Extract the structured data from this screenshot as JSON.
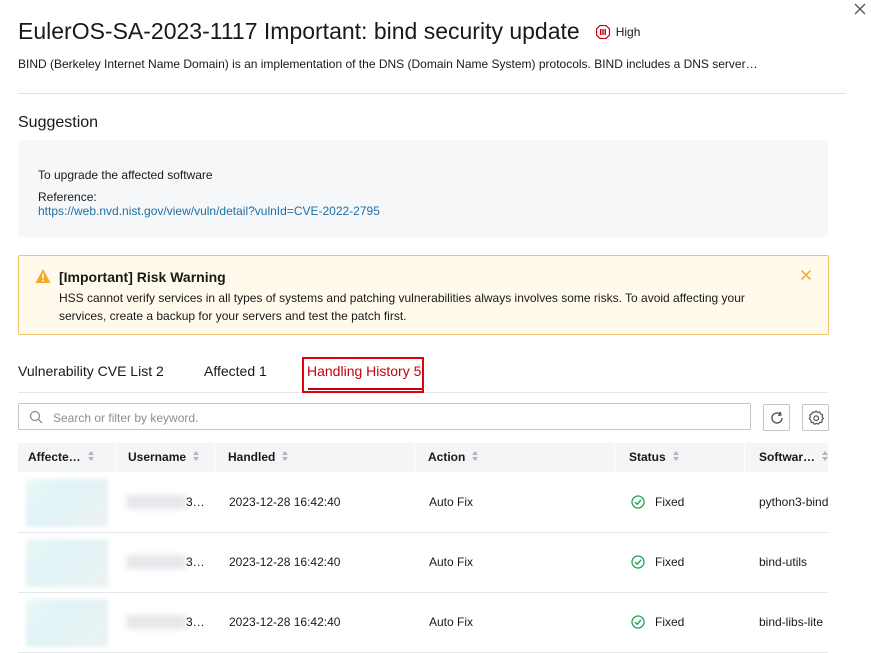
{
  "header": {
    "title": "EulerOS-SA-2023-1117 Important: bind security update",
    "severity": "High",
    "description": "BIND (Berkeley Internet Name Domain) is an implementation of the DNS (Domain Name System) protocols. BIND includes a DNS server…"
  },
  "suggestion": {
    "title": "Suggestion",
    "text": "To upgrade the affected software",
    "reference_label": "Reference:",
    "reference_link": "https://web.nvd.nist.gov/view/vuln/detail?vulnId=CVE-2022-2795"
  },
  "warning": {
    "title": "[Important] Risk Warning",
    "text": "HSS cannot verify services in all types of systems and patching vulnerabilities always involves some risks. To avoid affecting your services, create a backup for your servers and test the patch first."
  },
  "tabs": [
    {
      "label": "Vulnerability CVE List 2",
      "active": false
    },
    {
      "label": "Affected 1",
      "active": false
    },
    {
      "label": "Handling History 5",
      "active": true
    }
  ],
  "search": {
    "placeholder": "Search or filter by keyword.",
    "value": ""
  },
  "table": {
    "columns": [
      "Affecte…",
      "Username",
      "Handled",
      "Action",
      "Status",
      "Softwar…"
    ],
    "rows": [
      {
        "username_suffix": "3…",
        "handled": "2023-12-28 16:42:40",
        "action": "Auto Fix",
        "status": "Fixed",
        "software": "python3-bind"
      },
      {
        "username_suffix": "3…",
        "handled": "2023-12-28 16:42:40",
        "action": "Auto Fix",
        "status": "Fixed",
        "software": "bind-utils"
      },
      {
        "username_suffix": "3…",
        "handled": "2023-12-28 16:42:40",
        "action": "Auto Fix",
        "status": "Fixed",
        "software": "bind-libs-lite"
      }
    ]
  },
  "colors": {
    "accent": "#c7000b",
    "link": "#1f6fa8",
    "warning": "#f5a623",
    "success": "#22a35a"
  }
}
